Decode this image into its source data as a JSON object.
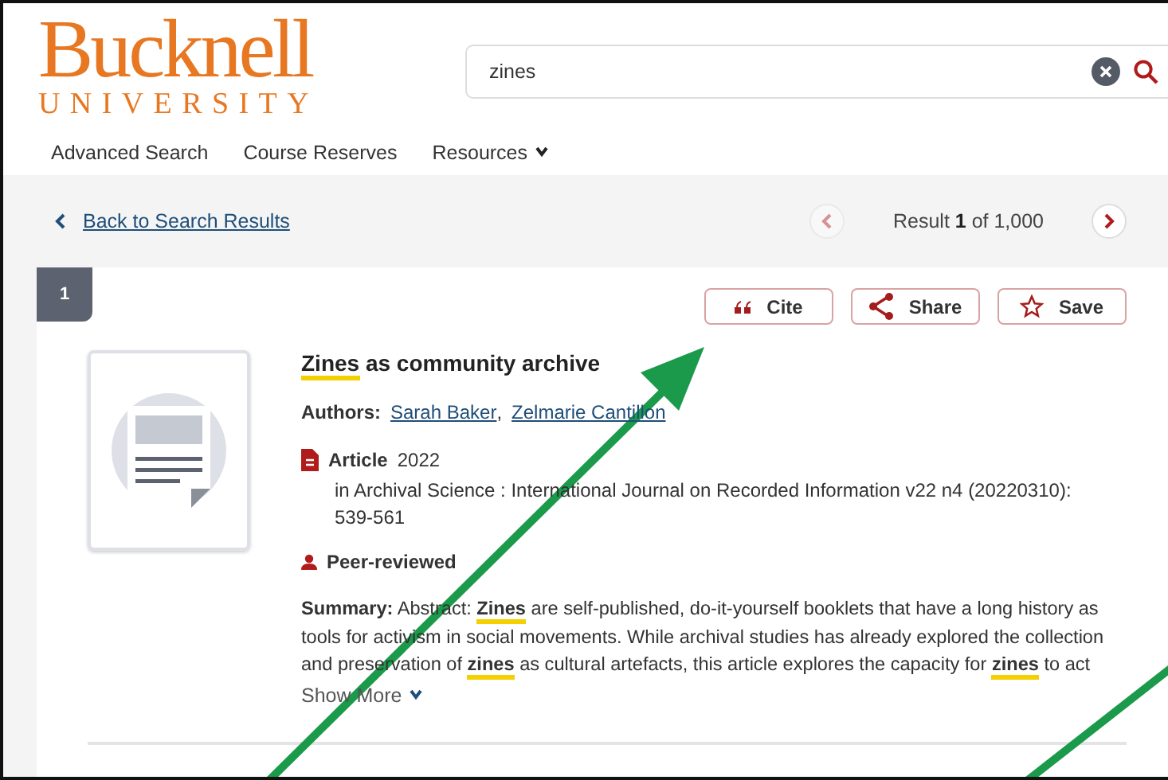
{
  "header": {
    "logo": {
      "name": "Bucknell",
      "subtitle": "UNIVERSITY"
    },
    "search": {
      "value": "zines"
    },
    "nav": [
      {
        "label": "Advanced Search",
        "kind": "link"
      },
      {
        "label": "Course Reserves",
        "kind": "link"
      },
      {
        "label": "Resources",
        "kind": "menu"
      }
    ]
  },
  "results_bar": {
    "back": "Back to Search Results",
    "counter": "Result **1** of 1,000",
    "previous": {
      "disabled": true
    },
    "next": {
      "disabled": false
    }
  },
  "record": {
    "number": "1",
    "actions": [
      {
        "label": "Cite",
        "kind": "cite"
      },
      {
        "label": "Share",
        "kind": "share"
      },
      {
        "label": "Save",
        "kind": "save"
      }
    ],
    "title": "**Zines** as community archive",
    "authors_label": "Authors:",
    "authors": [
      {
        "name": "Sarah Baker",
        "separator": ","
      },
      {
        "name": "Zelmarie Cantillon"
      }
    ],
    "format": {
      "type": "Article",
      "year": "2022"
    },
    "source": "in Archival Science : International Journal on Recorded Information  v22 n4 (20220310): 539-561",
    "peer_reviewed": "Peer-reviewed",
    "summary_label": "Summary:",
    "summary": "Abstract: **Zines** are self-published, do-it-yourself booklets that have a long history as tools for activism in social movements. While archival studies has already explored the collection and preservation of **zines** as cultural artefacts, this article explores the capacity for **zines** to act",
    "show_more": "Show More"
  },
  "annotations": [
    {
      "kind": "arrow"
    },
    {
      "kind": "line"
    }
  ]
}
